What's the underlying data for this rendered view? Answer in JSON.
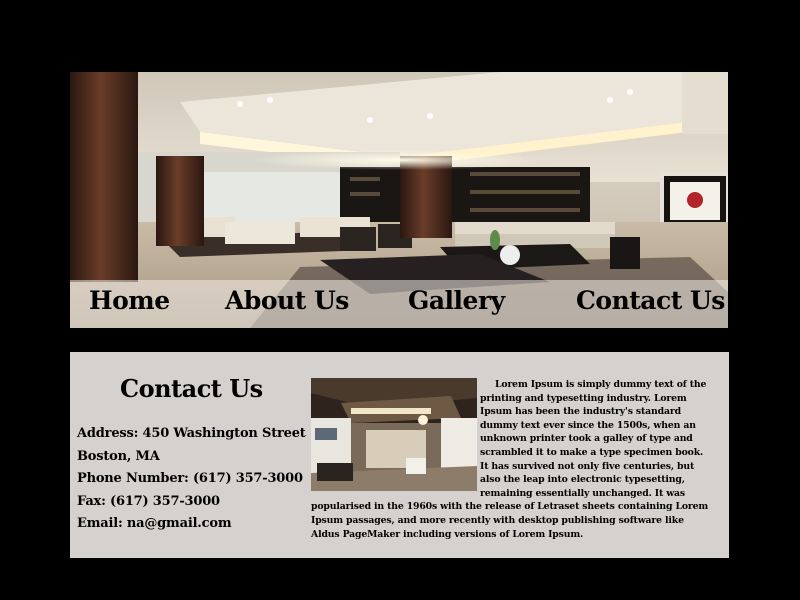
{
  "nav": {
    "items": [
      {
        "label": "Home"
      },
      {
        "label": "About Us"
      },
      {
        "label": "Gallery"
      },
      {
        "label": "Contact Us"
      }
    ]
  },
  "contact": {
    "title": "Contact Us",
    "lines": [
      "Address: 450 Washington Street",
      "Boston, MA",
      "Phone Number: (617) 357-3000",
      "Fax: (617) 357-3000",
      "Email: na@gmail.com"
    ]
  },
  "content": {
    "paragraph": "Lorem Ipsum is simply dummy text of the printing and typesetting industry. Lorem Ipsum has been the industry's standard dummy text ever since the 1500s, when an unknown printer took a galley of type and scrambled it to make a type specimen book. It has survived not only five centuries, but also the leap into electronic typesetting, remaining essentially unchanged. It was popularised in the 1960s with the release of Letraset sheets containing Lorem Ipsum passages, and more recently with desktop publishing software like Aldus PageMaker including versions of Lorem Ipsum."
  },
  "colors": {
    "page_background": "#000000",
    "content_panel": "#d4d1cf",
    "text": "#000000"
  }
}
